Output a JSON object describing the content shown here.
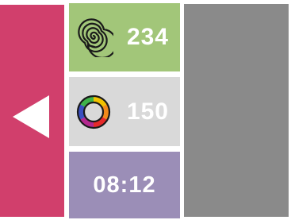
{
  "tiles": {
    "spiral": {
      "icon": "spiral-icon",
      "value": "234",
      "color": "#a2c679"
    },
    "color_wheel": {
      "icon": "color-wheel-icon",
      "value": "150",
      "color": "#d9d9d9"
    },
    "time": {
      "value": "08:12",
      "color": "#9b8eb7"
    }
  },
  "left_panel": {
    "icon": "back-arrow-icon",
    "color": "#d13f6c"
  },
  "right_panel": {
    "color": "#8a8a8a"
  }
}
